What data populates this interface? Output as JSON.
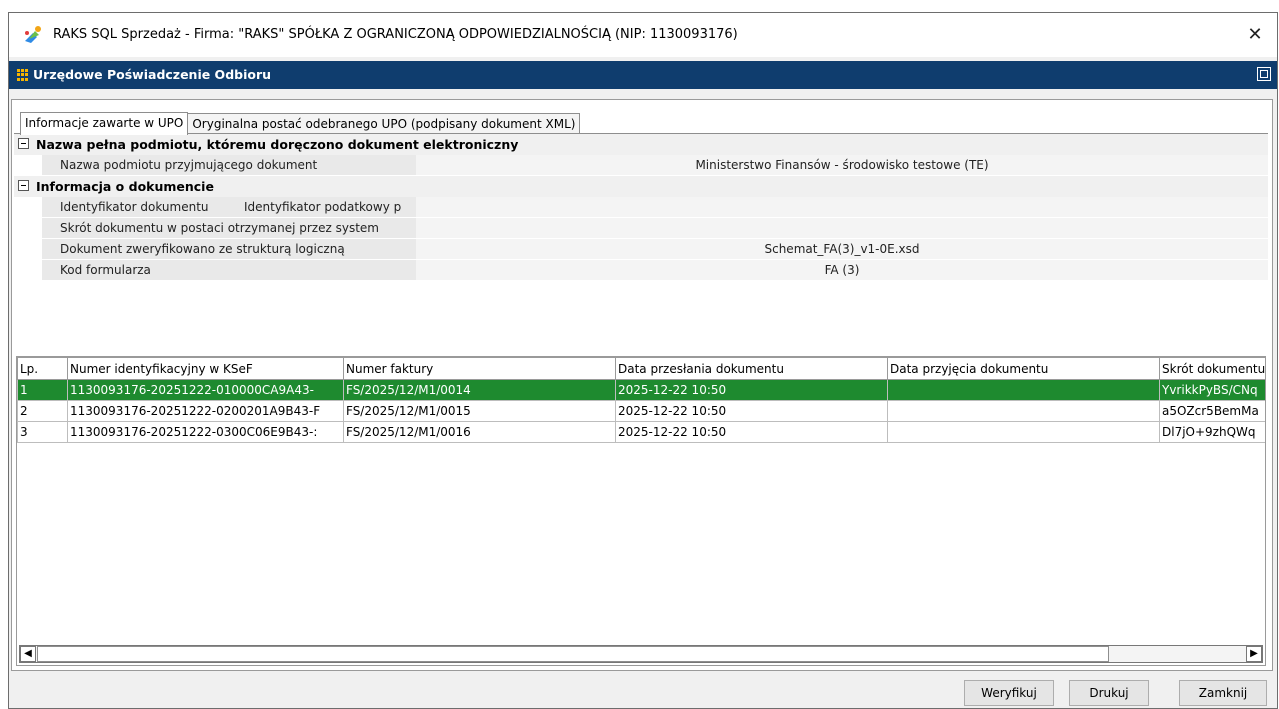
{
  "window": {
    "title": "RAKS SQL Sprzedaż - Firma: \"RAKS\" SPÓŁKA Z OGRANICZONĄ ODPOWIEDZIALNOŚCIĄ (NIP: 1130093176)",
    "close_symbol": "✕"
  },
  "header": {
    "title": "Urzędowe Poświadczenie Odbioru"
  },
  "tabs": [
    {
      "label": "Informacje zawarte w UPO"
    },
    {
      "label": "Oryginalna postać odebranego UPO (podpisany dokument XML)"
    }
  ],
  "groups": [
    {
      "title": "Nazwa pełna podmiotu, któremu doręczono dokument elektroniczny",
      "rows": [
        {
          "label": "Nazwa podmiotu przyjmującego dokument",
          "value": "Ministerstwo Finansów - środowisko testowe (TE)"
        }
      ]
    },
    {
      "title": "Informacja o dokumencie",
      "rows": [
        {
          "label": "Identyfikator dokumentu",
          "sub_label": "Identyfikator podatkowy p",
          "value": ""
        },
        {
          "label": "Skrót dokumentu w postaci otrzymanej przez system",
          "value": ""
        },
        {
          "label": "Dokument zweryfikowano ze strukturą logiczną",
          "value": "Schemat_FA(3)_v1-0E.xsd"
        },
        {
          "label": "Kod formularza",
          "value": "FA (3)"
        }
      ]
    }
  ],
  "table": {
    "columns": [
      "Lp.",
      "Numer identyfikacyjny w KSeF",
      "Numer faktury",
      "Data przesłania dokumentu",
      "Data przyjęcia dokumentu",
      "Skrót dokumentu"
    ],
    "rows": [
      [
        "1",
        "1130093176-20251222-010000CA9A43-",
        "FS/2025/12/M1/0014",
        "2025-12-22 10:50",
        "",
        "YvrikkPyBS/CNq"
      ],
      [
        "2",
        "1130093176-20251222-0200201A9B43-F",
        "FS/2025/12/M1/0015",
        "2025-12-22 10:50",
        "",
        "a5OZcr5BemMa"
      ],
      [
        "3",
        "1130093176-20251222-0300C06E9B43-:",
        "FS/2025/12/M1/0016",
        "2025-12-22 10:50",
        "",
        "Dl7jO+9zhQWq"
      ]
    ],
    "selected_row": 0
  },
  "scroll": {
    "left_arrow": "◀",
    "right_arrow": "▶"
  },
  "buttons": {
    "verify": "Weryfikuj",
    "print": "Drukuj",
    "close": "Zamknij"
  },
  "colors": {
    "header_bg": "#0f3d6e",
    "selected_row": "#1e8a2f"
  }
}
